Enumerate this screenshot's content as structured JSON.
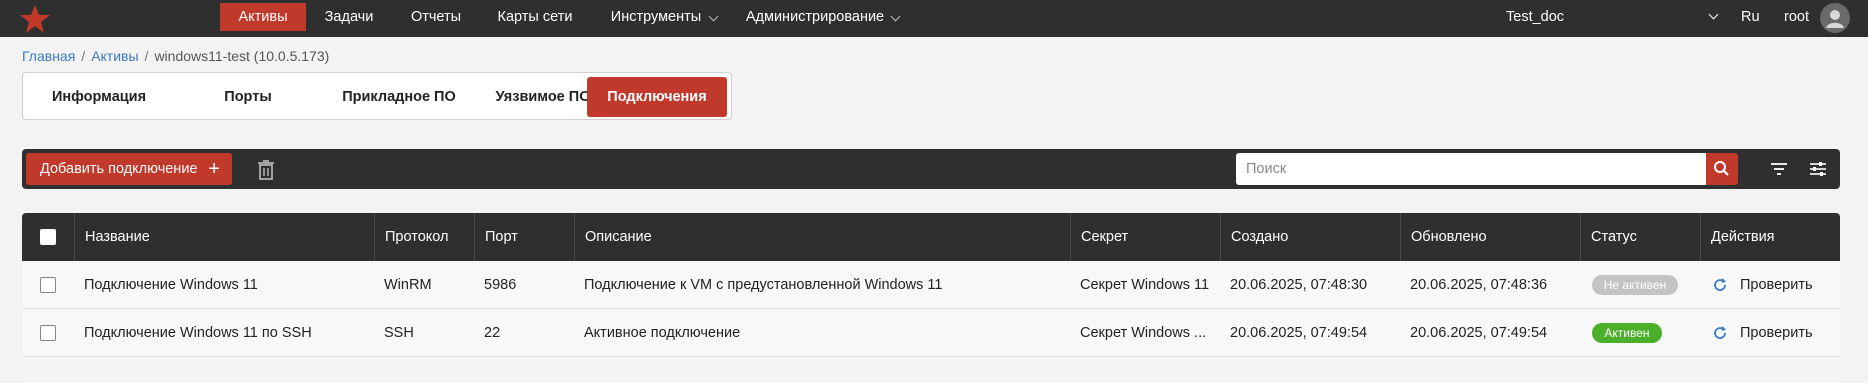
{
  "nav": {
    "items": [
      "Активы",
      "Задачи",
      "Отчеты",
      "Карты сети",
      "Инструменты",
      "Администрирование"
    ],
    "active_index": 0,
    "project": "Test_doc",
    "language": "Ru",
    "user": "root"
  },
  "breadcrumb": {
    "home": "Главная",
    "assets": "Активы",
    "current": "windows11-test (10.0.5.173)"
  },
  "tabs": {
    "items": [
      "Информация",
      "Порты",
      "Прикладное ПО",
      "Уязвимое ПО",
      "Подключения"
    ],
    "active_index": 4
  },
  "toolbar": {
    "add_label": "Добавить подключение",
    "add_plus": "+",
    "search_placeholder": "Поиск"
  },
  "table": {
    "columns": [
      "Название",
      "Протокол",
      "Порт",
      "Описание",
      "Секрет",
      "Создано",
      "Обновлено",
      "Статус",
      "Действия"
    ],
    "rows": [
      {
        "name": "Подключение Windows 11",
        "protocol": "WinRM",
        "port": "5986",
        "description": "Подключение к VM с предустановленной Windows 11",
        "secret": "Секрет Windows 11",
        "created": "20.06.2025, 07:48:30",
        "updated": "20.06.2025, 07:48:36",
        "status": "Не активен",
        "status_color": "#c4c4c4",
        "action": "Проверить"
      },
      {
        "name": "Подключение Windows 11 по SSH",
        "protocol": "SSH",
        "port": "22",
        "description": "Активное подключение",
        "secret": "Секрет Windows ...",
        "created": "20.06.2025, 07:49:54",
        "updated": "20.06.2025, 07:49:54",
        "status": "Активен",
        "status_color": "#4caf2a",
        "action": "Проверить"
      }
    ]
  },
  "colors": {
    "accent": "#c0392b",
    "header": "#2f2f2f",
    "link": "#3b7bc0"
  }
}
